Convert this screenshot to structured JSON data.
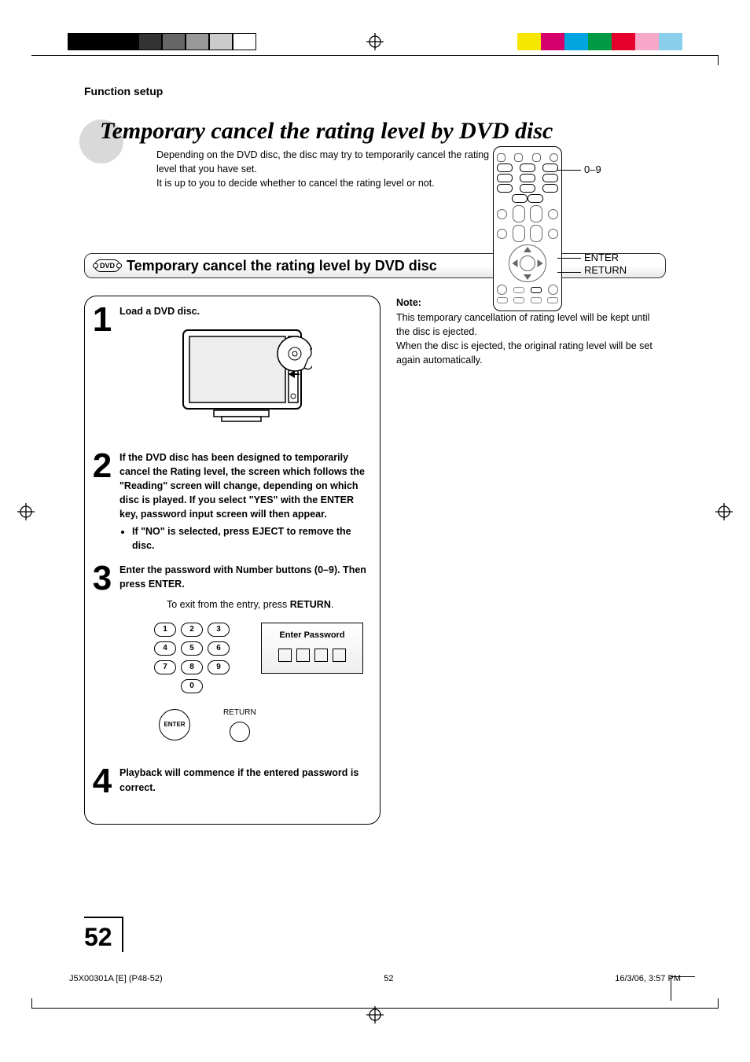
{
  "header": {
    "section": "Function setup"
  },
  "title": "Temporary cancel the rating level by DVD disc",
  "intro1": "Depending on the DVD disc, the disc may try to temporarily cancel the rating level that you have set.",
  "intro2": "It is up to you to decide whether to cancel the rating level or not.",
  "remote_labels": {
    "keypad": "0–9",
    "enter": "ENTER",
    "return": "RETURN"
  },
  "subtitle": "Temporary cancel the rating level by DVD disc",
  "dvd_chip": "DVD",
  "steps": {
    "s1": {
      "num": "1",
      "text": "Load a DVD disc."
    },
    "s2": {
      "num": "2",
      "text": "If the DVD disc has been designed to temporarily cancel the Rating level, the screen which follows the \"Reading\" screen will change, depending on which disc is played. If you select \"YES\" with the ENTER key, password input screen will then appear.",
      "bullet": "If \"NO\" is selected, press EJECT to remove the disc."
    },
    "s3": {
      "num": "3",
      "text": "Enter the password with Number buttons (0–9). Then press ENTER.",
      "sub1": "To exit from the entry, press ",
      "sub2": "RETURN"
    },
    "s4": {
      "num": "4",
      "text": "Playback will commence if the entered password is correct."
    }
  },
  "password_box": {
    "title": "Enter Password"
  },
  "keypad": {
    "k1": "1",
    "k2": "2",
    "k3": "3",
    "k4": "4",
    "k5": "5",
    "k6": "6",
    "k7": "7",
    "k8": "8",
    "k9": "9",
    "k0": "0"
  },
  "buttons": {
    "enter": "ENTER",
    "return": "RETURN"
  },
  "note": {
    "heading": "Note:",
    "line1": "This temporary cancellation of rating level will be kept until the disc is ejected.",
    "line2": "When the disc is ejected, the original rating level will be set again automatically."
  },
  "footer": {
    "left": "J5X00301A [E] (P48-52)",
    "center": "52",
    "right": "16/3/06, 3:57 PM",
    "page": "52"
  },
  "print_colors": {
    "bw": [
      "#000",
      "#000",
      "#000",
      "#222",
      "#555",
      "#888",
      "#bbb",
      "#fff"
    ],
    "cmyk": [
      "#f6e600",
      "#d6006c",
      "#00a5df",
      "#009944",
      "#e4002b",
      "#f7a8c9",
      "#89cfeb"
    ]
  },
  "chip_dot": "."
}
